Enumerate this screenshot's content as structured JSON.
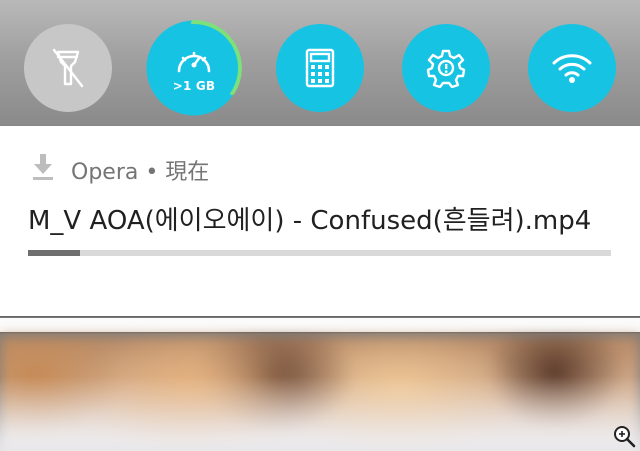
{
  "quick_settings": {
    "tiles": [
      {
        "name": "flashlight",
        "icon": "flashlight-off-icon",
        "state": "off"
      },
      {
        "name": "data-usage",
        "icon": "speedometer-icon",
        "label": ">1 GB",
        "state": "on"
      },
      {
        "name": "calculator",
        "icon": "calculator-icon",
        "state": "on"
      },
      {
        "name": "settings",
        "icon": "gear-icon",
        "state": "on"
      },
      {
        "name": "wifi",
        "icon": "wifi-icon",
        "state": "on"
      }
    ],
    "accent_color": "#16c3e3",
    "ring_color": "#7ee07a"
  },
  "notification": {
    "app_line": "Opera • 現在",
    "title": "M_V AOA(에이오에이) - Confused(흔들려).mp4",
    "progress_fraction": 0.09
  },
  "icons": {
    "download": "download-icon",
    "zoom": "zoom-icon"
  }
}
